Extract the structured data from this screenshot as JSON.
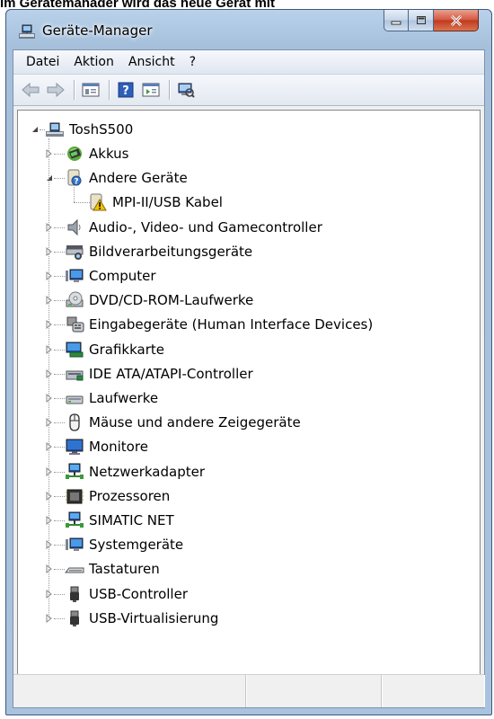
{
  "caption_fragment": "Im Gerätemanager wird das neue Gerät mit",
  "window": {
    "title": "Geräte-Manager"
  },
  "menu": [
    "Datei",
    "Aktion",
    "Ansicht",
    "?"
  ],
  "toolbar": {
    "buttons": [
      "back-arrow-icon",
      "forward-arrow-icon",
      "properties-icon",
      "help-icon",
      "view-icon",
      "scan-hardware-icon"
    ]
  },
  "tree": {
    "root": "ToshS500",
    "items": [
      {
        "label": "Akkus",
        "icon": "battery-icon"
      },
      {
        "label": "Andere Geräte",
        "icon": "unknown-device-icon",
        "expanded": true,
        "children": [
          {
            "label": "MPI-II/USB Kabel",
            "icon": "warning-device-icon"
          }
        ]
      },
      {
        "label": "Audio-, Video- und Gamecontroller",
        "icon": "speaker-icon"
      },
      {
        "label": "Bildverarbeitungsgeräte",
        "icon": "scanner-icon"
      },
      {
        "label": "Computer",
        "icon": "computer-icon"
      },
      {
        "label": "DVD/CD-ROM-Laufwerke",
        "icon": "dvd-drive-icon"
      },
      {
        "label": "Eingabegeräte (Human Interface Devices)",
        "icon": "hid-icon"
      },
      {
        "label": "Grafikkarte",
        "icon": "display-adapter-icon"
      },
      {
        "label": "IDE ATA/ATAPI-Controller",
        "icon": "ide-controller-icon"
      },
      {
        "label": "Laufwerke",
        "icon": "disk-drive-icon"
      },
      {
        "label": "Mäuse und andere Zeigegeräte",
        "icon": "mouse-icon"
      },
      {
        "label": "Monitore",
        "icon": "monitor-icon"
      },
      {
        "label": "Netzwerkadapter",
        "icon": "network-adapter-icon"
      },
      {
        "label": "Prozessoren",
        "icon": "processor-icon"
      },
      {
        "label": "SIMATIC NET",
        "icon": "simatic-net-icon"
      },
      {
        "label": "Systemgeräte",
        "icon": "system-device-icon"
      },
      {
        "label": "Tastaturen",
        "icon": "keyboard-icon"
      },
      {
        "label": "USB-Controller",
        "icon": "usb-icon"
      },
      {
        "label": "USB-Virtualisierung",
        "icon": "usb-virtual-icon"
      }
    ]
  },
  "colors": {
    "title_bar": "#b9d1ea",
    "close_button": "#c0391d",
    "warning": "#f2c200"
  }
}
